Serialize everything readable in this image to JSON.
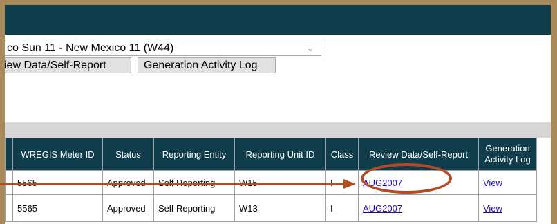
{
  "form": {
    "selected_unit": "co Sun 11 - New Mexico 11 (W44)",
    "review_button": "iew Data/Self-Report",
    "activity_log_button": "Generation Activity Log"
  },
  "table": {
    "headers": {
      "meter_id": "WREGIS Meter ID",
      "status": "Status",
      "reporting_entity": "Reporting Entity",
      "reporting_unit_id": "Reporting Unit ID",
      "class": "Class",
      "review": "Review Data/Self-Report",
      "activity_log_line1": "Generation",
      "activity_log_line2": "Activity Log"
    },
    "rows": [
      {
        "meter_id": "5565",
        "status": "Approved",
        "reporting_entity": "Self Reporting",
        "reporting_unit_id": "W15",
        "class": "I",
        "review": "AUG2007",
        "activity_log": "View"
      },
      {
        "meter_id": "5565",
        "status": "Approved",
        "reporting_entity": "Self Reporting",
        "reporting_unit_id": "W13",
        "class": "I",
        "review": "AUG2007",
        "activity_log": "View"
      }
    ]
  },
  "colors": {
    "header_bg": "#0f3d4c",
    "frame": "#a8895a",
    "annotation": "#b54b21",
    "link": "#1a0dab"
  },
  "icons": {
    "dropdown": "chevron-down-icon",
    "annotation": "arrow-right-icon"
  }
}
